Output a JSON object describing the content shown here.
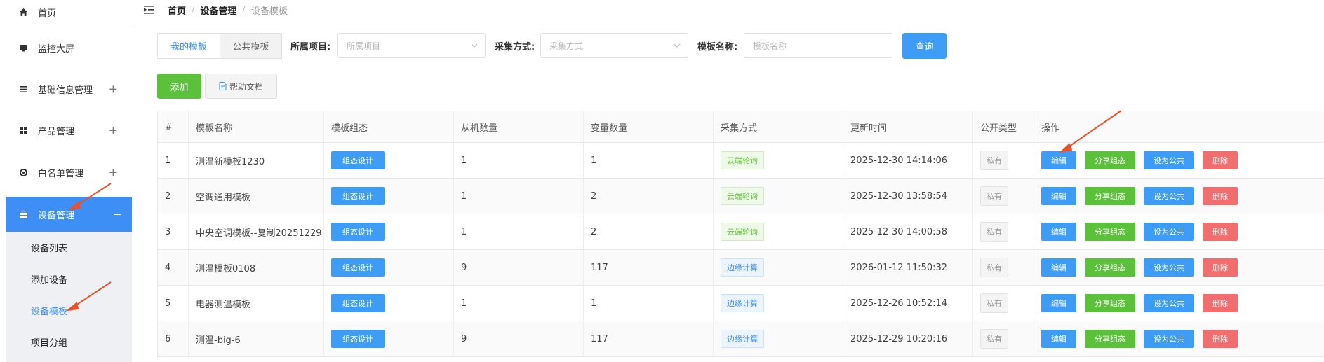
{
  "sidebar": {
    "items": [
      {
        "label": "首页",
        "icon": "home-icon"
      },
      {
        "label": "监控大屏",
        "icon": "monitor-icon"
      },
      {
        "label": "基础信息管理",
        "icon": "list-icon",
        "expand": "+"
      },
      {
        "label": "产品管理",
        "icon": "grid-icon",
        "expand": "+"
      },
      {
        "label": "白名单管理",
        "icon": "target-icon",
        "expand": "+"
      },
      {
        "label": "设备管理",
        "icon": "toolbox-icon",
        "expand": "−"
      }
    ],
    "sub_items": [
      "设备列表",
      "添加设备",
      "设备模板",
      "项目分组"
    ]
  },
  "breadcrumb": {
    "items": [
      "首页",
      "设备管理",
      "设备模板"
    ],
    "separator": "/"
  },
  "filters": {
    "tabs": [
      "我的模板",
      "公共模板"
    ],
    "project_label": "所属项目:",
    "project_placeholder": "所属项目",
    "method_label": "采集方式:",
    "method_placeholder": "采集方式",
    "name_label": "模板名称:",
    "name_placeholder": "模板名称",
    "query_button": "查询"
  },
  "toolbar": {
    "add_button": "添加",
    "help_button": "帮助文档"
  },
  "table": {
    "headers": [
      "#",
      "模板名称",
      "模板组态",
      "从机数量",
      "变量数量",
      "采集方式",
      "更新时间",
      "公开类型",
      "操作"
    ],
    "design_button": "组态设计",
    "actions": {
      "edit": "编辑",
      "share": "分享组态",
      "public": "设为公共",
      "delete": "删除"
    },
    "rows": [
      {
        "no": "1",
        "name": "测温新模板1230",
        "slaves": "1",
        "vars": "1",
        "method": "云端轮询",
        "method_type": "cloud",
        "updated": "2025-12-30 14:14:06",
        "visibility": "私有"
      },
      {
        "no": "2",
        "name": "空调通用模板",
        "slaves": "1",
        "vars": "2",
        "method": "云端轮询",
        "method_type": "cloud",
        "updated": "2025-12-30 13:58:54",
        "visibility": "私有"
      },
      {
        "no": "3",
        "name": "中央空调模板--复制20251229",
        "slaves": "1",
        "vars": "2",
        "method": "云端轮询",
        "method_type": "cloud",
        "updated": "2025-12-30 14:00:58",
        "visibility": "私有"
      },
      {
        "no": "4",
        "name": "测温模板0108",
        "slaves": "9",
        "vars": "117",
        "method": "边缘计算",
        "method_type": "edge",
        "updated": "2026-01-12 11:50:32",
        "visibility": "私有"
      },
      {
        "no": "5",
        "name": "电器测温模板",
        "slaves": "1",
        "vars": "1",
        "method": "边缘计算",
        "method_type": "edge",
        "updated": "2025-12-26 10:52:14",
        "visibility": "私有"
      },
      {
        "no": "6",
        "name": "测温-big-6",
        "slaves": "9",
        "vars": "117",
        "method": "边缘计算",
        "method_type": "edge",
        "updated": "2025-12-29 10:20:16",
        "visibility": "私有"
      }
    ]
  },
  "colors": {
    "primary": "#3d8ef5",
    "success": "#5cc13a",
    "danger": "#f26d6d",
    "annotation_arrow": "#e8512a"
  }
}
